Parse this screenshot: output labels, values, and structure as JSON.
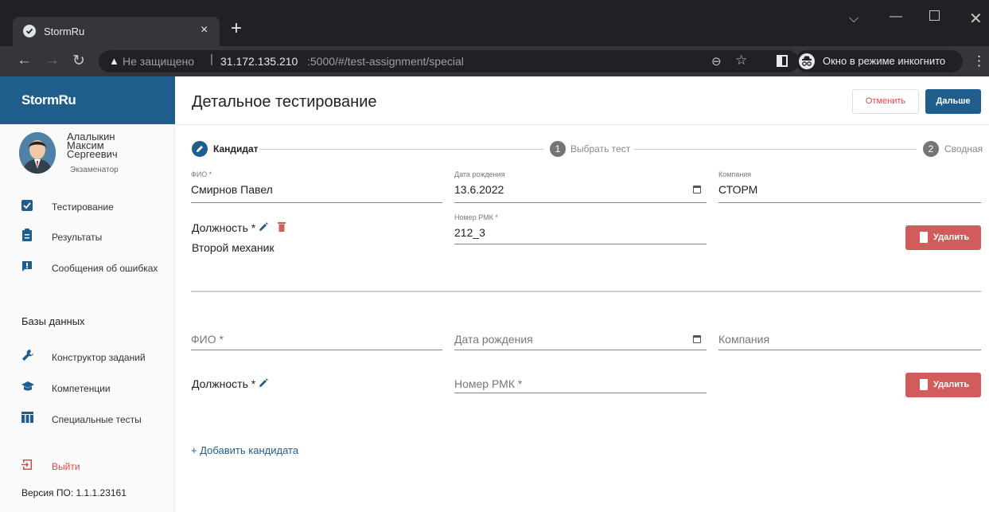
{
  "browser": {
    "tab_title": "StormRu",
    "tab_close": "×",
    "new_tab": "+",
    "not_secure": "Не защищено",
    "separator": "|",
    "url_host": "31.172.135.210",
    "url_path": ":5000/#/test-assignment/special",
    "incognito_label": "Окно в режиме инкогнито"
  },
  "sidebar": {
    "brand": "StormRu",
    "user": {
      "last_name": "Алалыкин",
      "first_name": "Максим",
      "patronymic": "Сергеевич",
      "role": "Экзаменатор"
    },
    "nav_items": [
      {
        "label": "Тестирование",
        "icon": "checkbox-icon"
      },
      {
        "label": "Результаты",
        "icon": "clipboard-icon"
      },
      {
        "label": "Сообщения об ошибках",
        "icon": "feedback-icon"
      }
    ],
    "db_heading": "Базы данных",
    "db_items": [
      {
        "label": "Конструктор заданий",
        "icon": "wrench-icon"
      },
      {
        "label": "Компетенции",
        "icon": "graduation-cap-icon"
      },
      {
        "label": "Специальные тесты",
        "icon": "table-icon"
      }
    ],
    "logout_label": "Выйти",
    "version": "Версия ПО: 1.1.1.23161"
  },
  "header": {
    "title": "Детальное тестирование",
    "cancel_label": "Отменить",
    "next_label": "Дальше"
  },
  "stepper": {
    "steps": [
      {
        "label": "Кандидат",
        "state": "edit"
      },
      {
        "label": "Выбрать тест",
        "number": "1"
      },
      {
        "label": "Сводная",
        "number": "2"
      }
    ]
  },
  "candidates": [
    {
      "fio_label": "ФИО *",
      "fio_value": "Смирнов Павел",
      "dob_label": "Дата рождения",
      "dob_value": "13.6.2022",
      "company_label": "Компания",
      "company_value": "СТОРМ",
      "position_label": "Должность *",
      "position_value": "Второй механик",
      "rmk_label": "Номер РМК *",
      "rmk_value": "212_3",
      "delete_label": "Удалить"
    },
    {
      "fio_label": "ФИО *",
      "dob_label": "Дата рождения",
      "company_label": "Компания",
      "position_label": "Должность *",
      "rmk_label": "Номер РМК *",
      "delete_label": "Удалить"
    }
  ],
  "add_candidate_label": "+ Добавить кандидата",
  "colors": {
    "primary": "#1f5d8c",
    "danger": "#d05c5c",
    "danger_text": "#d84a4a"
  }
}
